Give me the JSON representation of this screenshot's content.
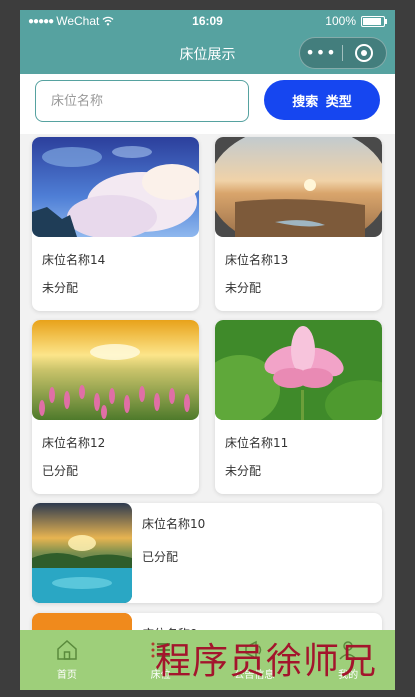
{
  "status_bar": {
    "signal_dots": "●●●●●",
    "carrier": "WeChat",
    "wifi_icon": "wifi-icon",
    "time": "16:09",
    "battery_text": "100%"
  },
  "nav": {
    "title": "床位展示",
    "more_icon": "•••",
    "target_icon": "record-icon"
  },
  "search": {
    "placeholder": "床位名称",
    "button_label": "搜索 类型"
  },
  "beds": [
    {
      "name": "床位名称14",
      "status": "未分配",
      "image": "anime-sky-clouds"
    },
    {
      "name": "床位名称13",
      "status": "未分配",
      "image": "desert-sunset"
    },
    {
      "name": "床位名称12",
      "status": "已分配",
      "image": "flower-field-sunset"
    },
    {
      "name": "床位名称11",
      "status": "未分配",
      "image": "pink-lotus"
    },
    {
      "name": "床位名称10",
      "status": "已分配",
      "image": "lake-sunset"
    },
    {
      "name": "床位名称9",
      "status": "",
      "image": "orange-sunset"
    }
  ],
  "tab_bar": {
    "items": [
      {
        "label": "首页",
        "icon": "home-icon"
      },
      {
        "label": "床位",
        "icon": "list-icon"
      },
      {
        "label": "公告信息",
        "icon": "notice-icon"
      },
      {
        "label": "我的",
        "icon": "user-icon"
      }
    ]
  },
  "watermark": "程序员徐师兄",
  "colors": {
    "nav": "#56a2a0",
    "search_button": "#1646f0",
    "tab_bar": "#9ecf7a",
    "watermark": "#a3152c"
  }
}
